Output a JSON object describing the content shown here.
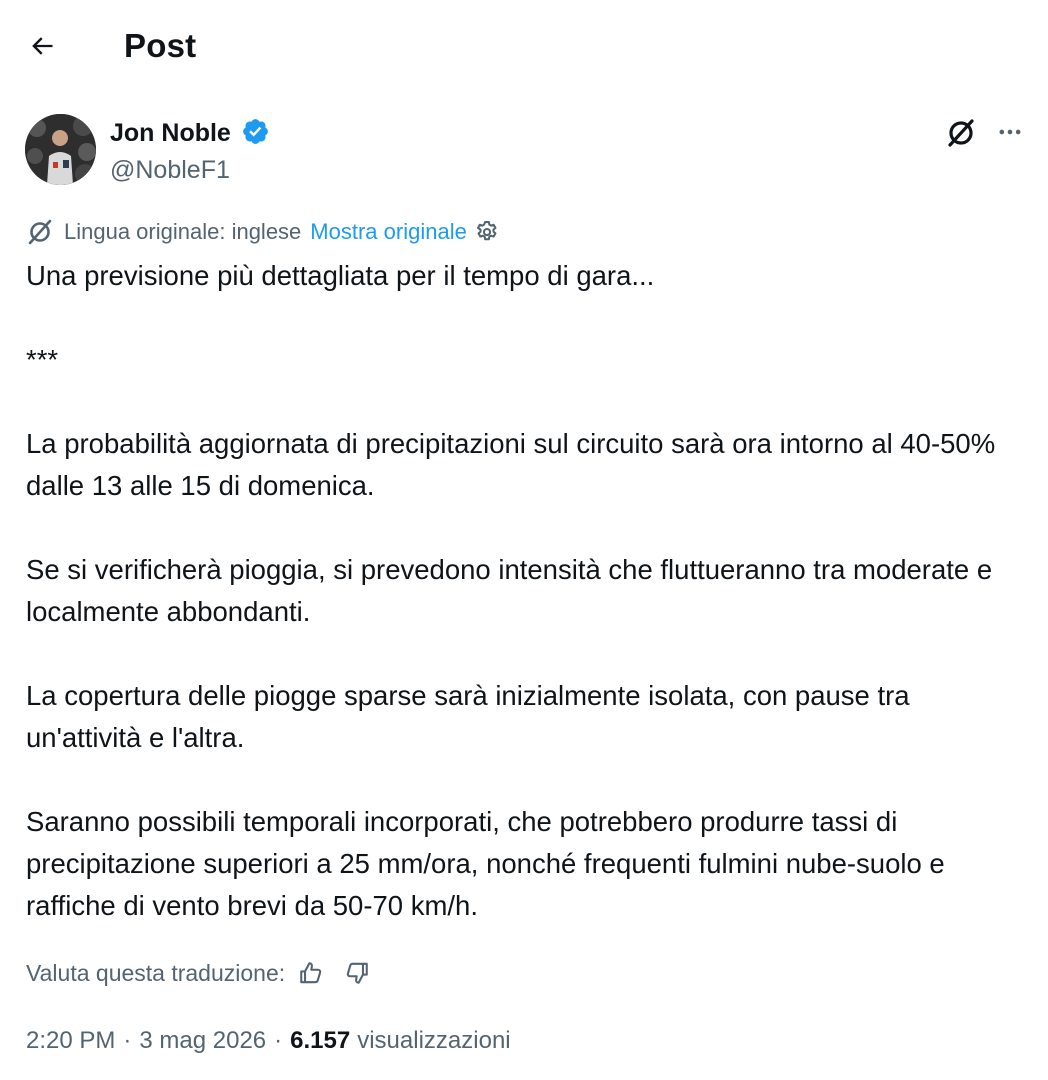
{
  "header": {
    "title": "Post",
    "back_icon": "arrow-left-icon"
  },
  "author": {
    "name": "Jon Noble",
    "handle": "@NobleF1",
    "verified": true,
    "verified_color": "#1d9bf0"
  },
  "actions": {
    "grok_icon": "grok-icon",
    "more_icon": "more-dots-icon"
  },
  "translation": {
    "original_language": "Lingua originale: inglese",
    "show_original": "Mostra originale",
    "settings_icon": "gear-icon",
    "link_color": "#1d9bf0"
  },
  "post": {
    "paragraphs": [
      "Una previsione più dettagliata per il tempo di gara...",
      "***",
      "La probabilità aggiornata di precipitazioni sul circuito sarà ora intorno al 40-50% dalle 13 alle 15 di domenica.",
      "Se si verificherà pioggia, si prevedono intensità che fluttueranno tra moderate e localmente abbondanti.",
      "La copertura delle piogge sparse sarà inizialmente isolata, con pause tra un'attività e l'altra.",
      "Saranno possibili temporali incorporati, che potrebbero produrre tassi di precipitazione superiori a 25 mm/ora, nonché frequenti fulmini nube-suolo e raffiche di vento brevi da 50-70 km/h."
    ]
  },
  "rating": {
    "label": "Valuta questa traduzione:",
    "thumbs_up_icon": "thumbs-up-icon",
    "thumbs_down_icon": "thumbs-down-icon"
  },
  "meta": {
    "time": "2:20 PM",
    "separator": "·",
    "date": "3 mag 2026",
    "views_count": "6.157",
    "views_label": "visualizzazioni"
  }
}
